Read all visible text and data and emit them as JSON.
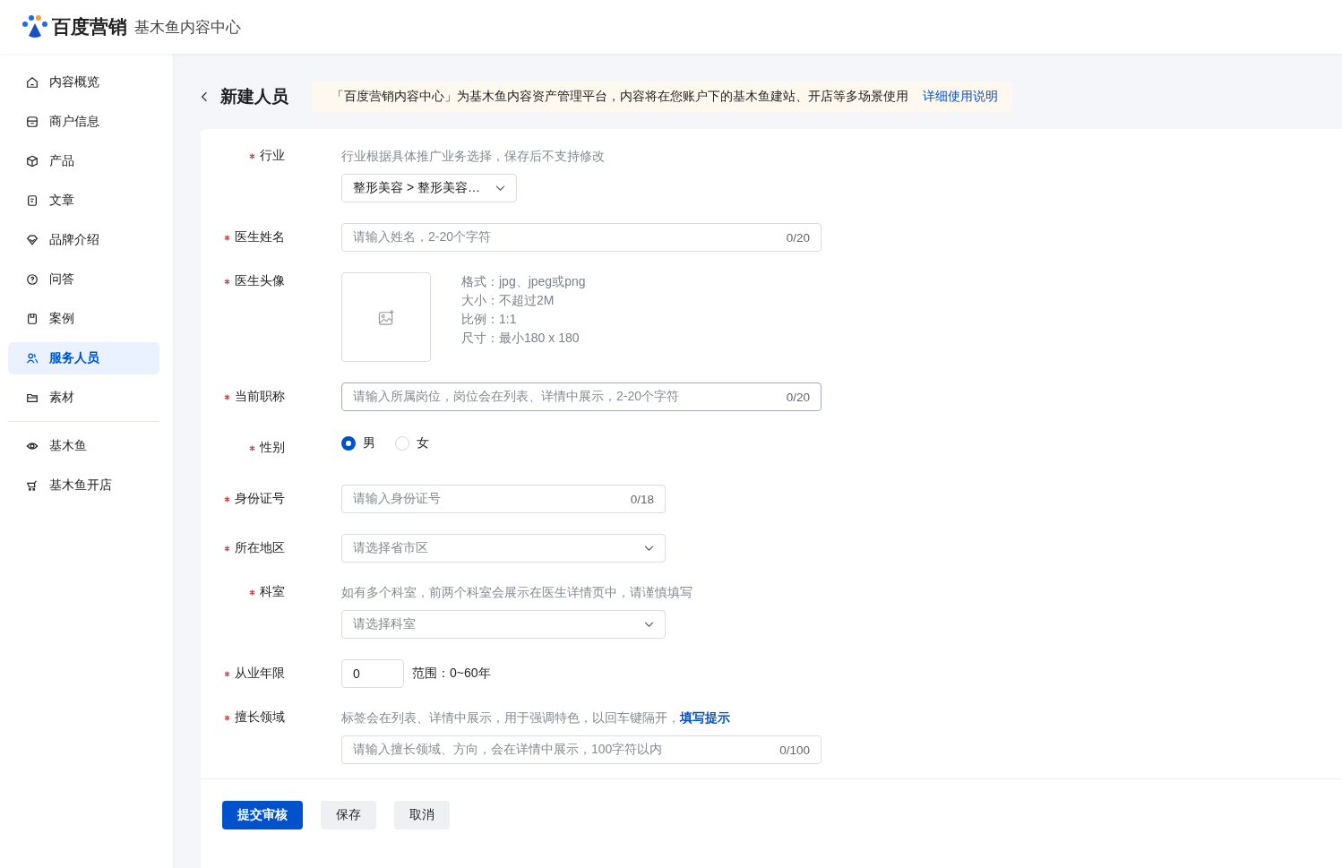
{
  "header": {
    "brand": "百度营销",
    "product": "基木鱼内容中心"
  },
  "sidebar": {
    "groups": [
      {
        "items": [
          {
            "label": "内容概览",
            "selected": false
          },
          {
            "label": "商户信息",
            "selected": false
          },
          {
            "label": "产品",
            "selected": false
          },
          {
            "label": "文章",
            "selected": false
          },
          {
            "label": "品牌介绍",
            "selected": false
          },
          {
            "label": "问答",
            "selected": false
          },
          {
            "label": "案例",
            "selected": false
          },
          {
            "label": "服务人员",
            "selected": true
          },
          {
            "label": "素材",
            "selected": false
          }
        ]
      },
      {
        "items": [
          {
            "label": "基木鱼",
            "selected": false
          },
          {
            "label": "基木鱼开店",
            "selected": false
          }
        ]
      }
    ]
  },
  "page": {
    "title": "新建人员",
    "notice": {
      "text": "「百度营销内容中心」为基木鱼内容资产管理平台，内容将在您账户下的基木鱼建站、开店等多场景使用",
      "link": "详细使用说明"
    }
  },
  "form": {
    "fields": [
      {
        "kind": "select",
        "label": "行业",
        "required": true,
        "hint": "行业根据具体推广业务选择，保存后不支持修改",
        "value": "整形美容 > 整形美容…"
      },
      {
        "kind": "text",
        "label": "医生姓名",
        "required": true,
        "placeholder": "请输入姓名，2-20个字符",
        "counter": "0/20",
        "focused": false
      },
      {
        "kind": "upload",
        "label": "医生头像",
        "required": true,
        "specs": [
          "格式：jpg、jpeg或png",
          "大小：不超过2M",
          "比例：1:1",
          "尺寸：最小180 x 180"
        ]
      },
      {
        "kind": "text",
        "label": "当前职称",
        "required": true,
        "placeholder": "请输入所属岗位，岗位会在列表、详情中展示，2-20个字符",
        "counter": "0/20",
        "focused": true
      },
      {
        "kind": "radio",
        "label": "性别",
        "required": true,
        "options": [
          {
            "label": "男",
            "selected": true
          },
          {
            "label": "女",
            "selected": false
          }
        ]
      },
      {
        "kind": "text",
        "label": "身份证号",
        "required": true,
        "placeholder": "请输入身份证号",
        "counter": "0/18",
        "focused": false
      },
      {
        "kind": "select",
        "label": "所在地区",
        "required": true,
        "placeholder": "请选择省市区"
      },
      {
        "kind": "select",
        "label": "科室",
        "required": true,
        "hint": "如有多个科室，前两个科室会展示在医生详情页中，请谨慎填写",
        "placeholder": "请选择科室"
      },
      {
        "kind": "number",
        "label": "从业年限",
        "required": true,
        "value": "0",
        "note": "范围：0~60年"
      },
      {
        "kind": "text",
        "label": "擅长领域",
        "required": true,
        "hint": "标签会在列表、详情中展示，用于强调特色，以回车键隔开，",
        "hint_link": "填写提示",
        "placeholder": "请输入擅长领域、方向，会在详情中展示，100字符以内",
        "counter": "0/100",
        "focused": false
      }
    ]
  },
  "buttons": [
    {
      "label": "提交审核",
      "kind": "primary"
    },
    {
      "label": "保存",
      "kind": "secondary"
    },
    {
      "label": "取消",
      "kind": "secondary"
    }
  ]
}
